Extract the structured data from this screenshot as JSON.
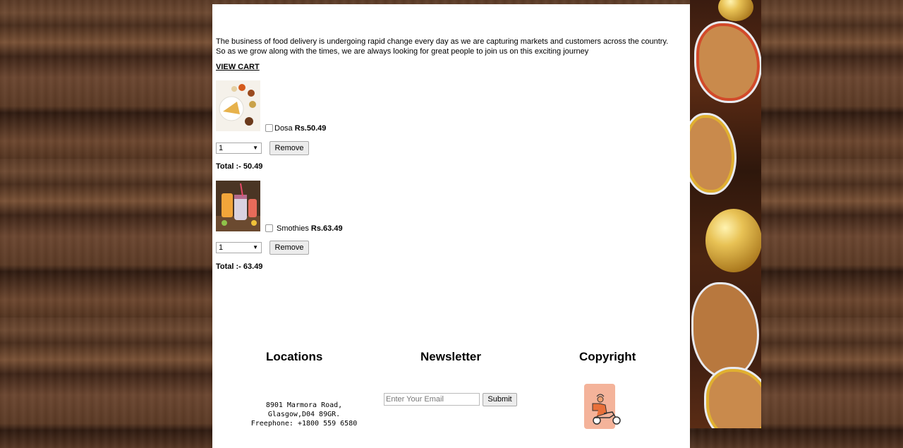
{
  "intro": {
    "line1": "The business of food delivery is undergoing rapid change every day as we are capturing markets and customers across the country.",
    "line2": "So as we grow along with the times, we are always looking for great people to join us on this exciting journey"
  },
  "view_cart": "VIEW CART",
  "cart": [
    {
      "name": "Dosa",
      "price": "Rs.50.49",
      "qty": "1",
      "remove_label": "Remove",
      "total": "Total :- 50.49"
    },
    {
      "name": "Smothies",
      "price": "Rs.63.49",
      "qty": "1",
      "remove_label": "Remove",
      "total": "Total :- 63.49"
    }
  ],
  "footer": {
    "locations_title": "Locations",
    "address_line1": "8901 Marmora Road,",
    "address_line2": "Glasgow,D04 89GR.",
    "address_line3": "Freephone: +1800 559 6580",
    "newsletter_title": "Newsletter",
    "email_placeholder": "Enter Your Email",
    "submit_label": "Submit",
    "copyright_title": "Copyright"
  },
  "icons": {
    "qty_dropdown": "chevron-down-icon",
    "delivery_logo": "delivery-scooter-icon"
  },
  "colors": {
    "page_bg": "#ffffff",
    "logo_bg": "#f4b39a"
  }
}
